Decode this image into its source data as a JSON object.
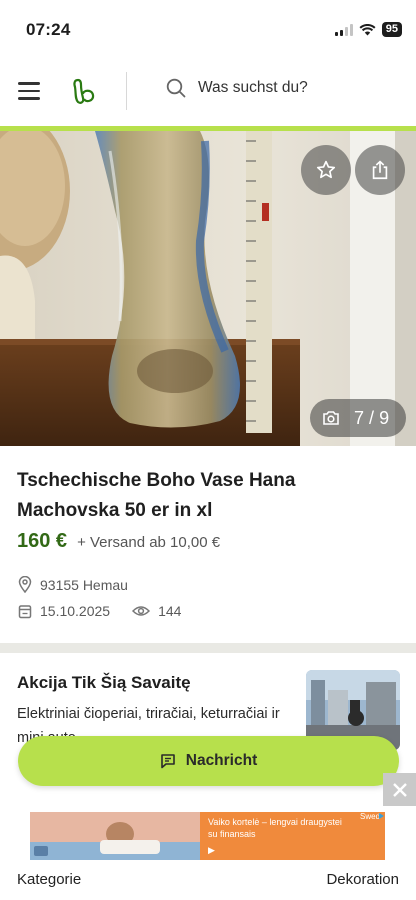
{
  "status_bar": {
    "time": "07:24",
    "battery": "95"
  },
  "header": {
    "search_placeholder": "Was suchst du?"
  },
  "gallery": {
    "current": "7",
    "separator": "/",
    "total": "9"
  },
  "listing": {
    "title": "Tschechische Boho Vase Hana Machovska 50 er in xl",
    "price": "160 €",
    "shipping": "+ Versand ab 10,00 €",
    "location": "93155 Hemau",
    "date": "15.10.2025",
    "views": "144"
  },
  "ad": {
    "title": "Akcija Tik Šią Savaitę",
    "description": "Elektriniai čioperiai, triračiai, keturračiai ir mini auto"
  },
  "message_button": {
    "label": "Nachricht"
  },
  "banner": {
    "text": "Vaiko kortelė – lengvai draugystei su finansais",
    "arrow": "▶",
    "brand": "Swed"
  },
  "bottom": {
    "left": "Kategorie",
    "right": "Dekoration"
  },
  "colors": {
    "accent": "#b7e04c",
    "price": "#326916"
  },
  "icons": {
    "menu": "hamburger-icon",
    "logo": "kleinanzeigen-logo-icon",
    "search": "search-icon",
    "favorite": "star-icon",
    "share": "share-icon",
    "camera": "camera-icon",
    "location": "location-pin-icon",
    "calendar": "calendar-icon",
    "views": "eye-icon",
    "chat": "chat-icon",
    "close": "close-icon"
  }
}
